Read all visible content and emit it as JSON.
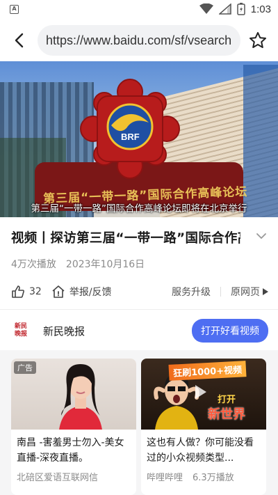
{
  "status_bar": {
    "time": "1:03",
    "left_icon": "A",
    "icons": [
      "wifi-icon",
      "signal-icon",
      "battery-icon"
    ]
  },
  "browser": {
    "url": "https://www.baidu.com/sf/vsearch",
    "back_icon": "back-arrow-icon",
    "bookmark_icon": "star-outline-icon"
  },
  "video": {
    "caption": "第三届“一带一路”国际合作高峰论坛即将在北京举行",
    "stage_text": "第三届“一带一路”国际合作高峰论坛",
    "logo_text": "BRF"
  },
  "article": {
    "title": "视频丨探访第三届“一带一路”国际合作高峰论坛",
    "views": "4万次播放",
    "date": "2023年10月16日"
  },
  "actions": {
    "like_count": "32",
    "report_label": "举报/反馈",
    "upgrade_label": "服务升级",
    "original_label": "原网页"
  },
  "source": {
    "logo_line1": "新民",
    "logo_line2": "晚报",
    "name": "新民晚报",
    "open_button": "打开好看视频"
  },
  "cards": [
    {
      "ad_tag": "广告",
      "title": "南昌 -害羞男士勿入-美女直播-深夜直播。",
      "source": "北碚区爱语互联网信"
    },
    {
      "title": "这也有人做？你可能没看过的小众视频类型...",
      "source": "哔哩哔哩",
      "views": "6.3万播放",
      "banner": "狂刷1000+视频",
      "banner2": "打开",
      "banner3": "新世界"
    }
  ],
  "colors": {
    "accent": "#4e6ef2",
    "source_red": "#c0262d"
  }
}
